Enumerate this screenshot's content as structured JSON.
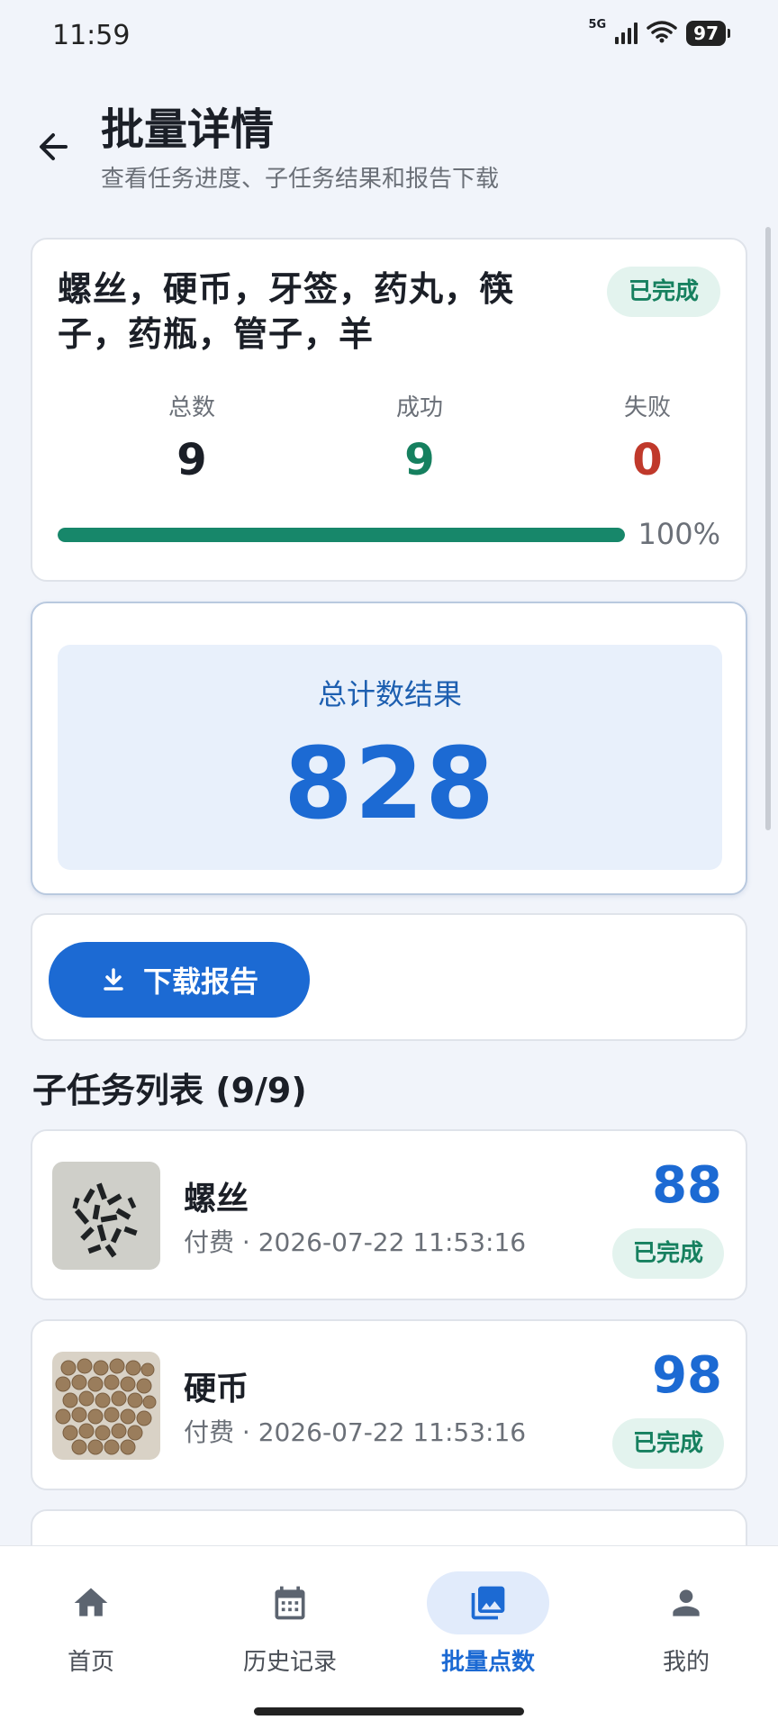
{
  "status_bar": {
    "time": "11:59",
    "network": "5G",
    "battery": "97"
  },
  "header": {
    "title": "批量详情",
    "subtitle": "查看任务进度、子任务结果和报告下载"
  },
  "summary": {
    "batch_name": "螺丝，硬币，牙签，药丸，筷子，药瓶，管子，羊",
    "status": "已完成",
    "total_label": "总数",
    "total_value": "9",
    "success_label": "成功",
    "success_value": "9",
    "failed_label": "失败",
    "failed_value": "0",
    "progress_fraction": 1.0,
    "progress_text": "100%"
  },
  "result": {
    "label": "总计数结果",
    "value": "828"
  },
  "download": {
    "label": "下载报告"
  },
  "subtasks": {
    "title": "子任务列表 (9/9)",
    "items": [
      {
        "name": "螺丝",
        "meta": "付费 · 2026-07-22 11:53:16",
        "count": "88",
        "status": "已完成"
      },
      {
        "name": "硬币",
        "meta": "付费 · 2026-07-22 11:53:16",
        "count": "98",
        "status": "已完成"
      }
    ]
  },
  "nav": {
    "items": [
      {
        "label": "首页",
        "icon": "home-icon"
      },
      {
        "label": "历史记录",
        "icon": "calendar-icon"
      },
      {
        "label": "批量点数",
        "icon": "photo-library-icon"
      },
      {
        "label": "我的",
        "icon": "person-icon"
      }
    ],
    "active_index": 2
  },
  "colors": {
    "accent": "#1c6ad3",
    "success": "#16805f",
    "danger": "#c0392b",
    "background": "#f1f4fa"
  }
}
